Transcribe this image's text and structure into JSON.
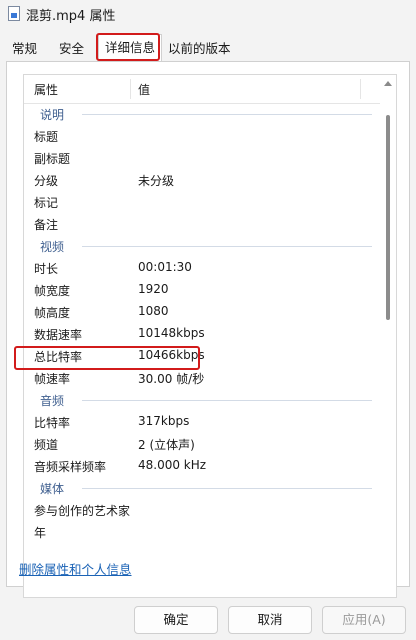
{
  "window": {
    "title": "混剪.mp4 属性"
  },
  "tabs": [
    {
      "label": "常规"
    },
    {
      "label": "安全"
    },
    {
      "label": "详细信息"
    },
    {
      "label": "以前的版本"
    }
  ],
  "table": {
    "headers": {
      "property": "属性",
      "value": "值"
    },
    "sections": [
      {
        "title": "说明",
        "rows": [
          {
            "name": "标题",
            "value": ""
          },
          {
            "name": "副标题",
            "value": ""
          },
          {
            "name": "分级",
            "value": "未分级"
          },
          {
            "name": "标记",
            "value": ""
          },
          {
            "name": "备注",
            "value": ""
          }
        ]
      },
      {
        "title": "视频",
        "rows": [
          {
            "name": "时长",
            "value": "00:01:30"
          },
          {
            "name": "帧宽度",
            "value": "1920"
          },
          {
            "name": "帧高度",
            "value": "1080"
          },
          {
            "name": "数据速率",
            "value": "10148kbps"
          },
          {
            "name": "总比特率",
            "value": "10466kbps"
          },
          {
            "name": "帧速率",
            "value": "30.00 帧/秒"
          }
        ]
      },
      {
        "title": "音频",
        "rows": [
          {
            "name": "比特率",
            "value": "317kbps"
          },
          {
            "name": "频道",
            "value": "2 (立体声)"
          },
          {
            "name": "音频采样频率",
            "value": "48.000 kHz"
          }
        ]
      },
      {
        "title": "媒体",
        "rows": [
          {
            "name": "参与创作的艺术家",
            "value": ""
          },
          {
            "name": "年",
            "value": ""
          }
        ]
      }
    ]
  },
  "footer": {
    "remove_link": "删除属性和个人信息"
  },
  "buttons": {
    "ok": "确定",
    "cancel": "取消",
    "apply": "应用(A)"
  },
  "colors": {
    "highlight": "#d21b1b",
    "section": "#3f5f8f",
    "link": "#1a62b5"
  }
}
